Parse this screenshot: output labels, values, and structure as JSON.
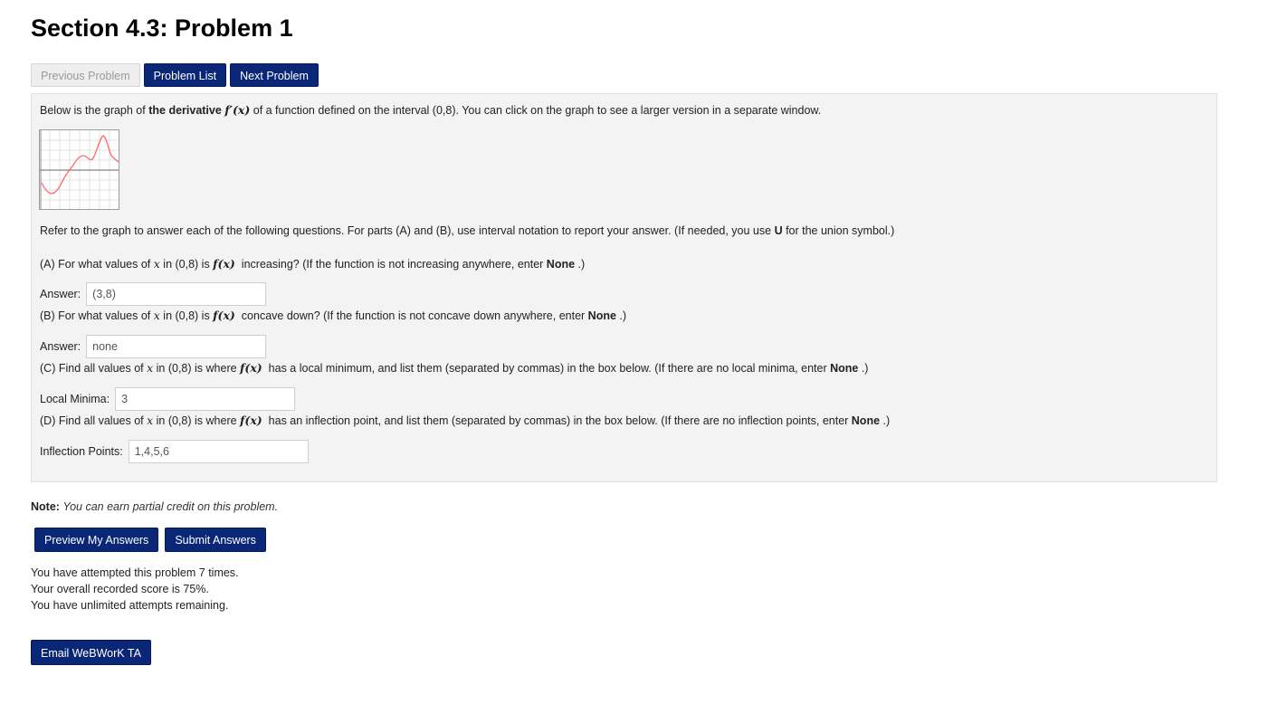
{
  "page_title": "Section 4.3: Problem 1",
  "nav": {
    "previous_label": "Previous Problem",
    "list_label": "Problem List",
    "next_label": "Next Problem"
  },
  "problem": {
    "intro": {
      "pre": "Below is the graph of ",
      "bold": "the derivative",
      "math": "f′(x)",
      "post": " of a function defined on the interval (0,8). You can click on the graph to see a larger version in a separate window."
    },
    "graph_alt": "graph of f'(x)",
    "refer": {
      "pre": "Refer to the graph to answer each of the following questions. For parts (A) and (B), use interval notation to report your answer. (If needed, you use ",
      "bold": "U",
      "post": " for the union symbol.)"
    },
    "qA": {
      "p1": "(A) For what values of ",
      "x": "x",
      "p2": " in (0,8) is ",
      "fx": "f(x)",
      "p3": " increasing? (If the function is not increasing anywhere, enter ",
      "none": "None",
      "p4": " .)"
    },
    "ansA": {
      "label": "Answer:",
      "value": "(3,8)"
    },
    "qB": {
      "p1": "(B) For what values of ",
      "x": "x",
      "p2": " in (0,8) is ",
      "fx": "f(x)",
      "p3": " concave down? (If the function is not concave down anywhere, enter ",
      "none": "None",
      "p4": " .)"
    },
    "ansB": {
      "label": "Answer:",
      "value": "none"
    },
    "qC": {
      "p1": "(C) Find all values of ",
      "x": "x",
      "p2": " in (0,8) is where ",
      "fx": "f(x)",
      "p3": " has a local minimum, and list them (separated by commas) in the box below. (If there are no local minima, enter ",
      "none": "None",
      "p4": " .)"
    },
    "ansC": {
      "label": "Local Minima:",
      "value": "3"
    },
    "qD": {
      "p1": "(D) Find all values of ",
      "x": "x",
      "p2": " in (0,8) is where ",
      "fx": "f(x)",
      "p3": " has an inflection point, and list them (separated by commas) in the box below. (If there are no inflection points, enter ",
      "none": "None",
      "p4": " .)"
    },
    "ansD": {
      "label": "Inflection Points:",
      "value": "1,4,5,6"
    }
  },
  "note": {
    "label": "Note:",
    "text": "You can earn partial credit on this problem."
  },
  "actions": {
    "preview_label": "Preview My Answers",
    "submit_label": "Submit Answers"
  },
  "status": {
    "attempts": "You have attempted this problem 7 times.",
    "score": "Your overall recorded score is 75%.",
    "remaining": "You have unlimited attempts remaining."
  },
  "email_label": "Email WeBWorK TA",
  "colors": {
    "button_bg": "#0a2677",
    "curve": "#ff6b6b"
  }
}
